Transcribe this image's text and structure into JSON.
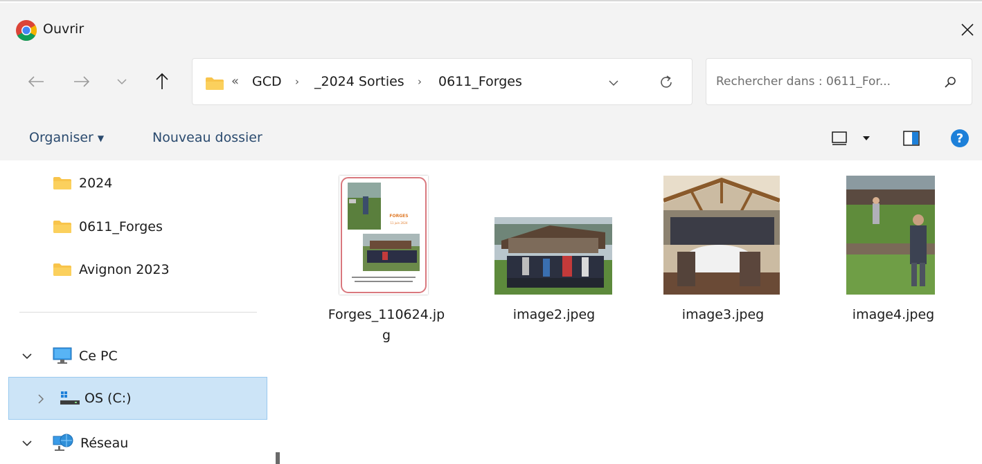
{
  "window": {
    "title": "Ouvrir"
  },
  "navigation": {
    "breadcrumbs": [
      "GCD",
      "_2024 Sorties",
      "0611_Forges"
    ],
    "overflow_glyph": "«",
    "separator_glyph": "›"
  },
  "search": {
    "placeholder": "Rechercher dans : 0611_For..."
  },
  "commands": {
    "organise_label": "Organiser",
    "new_folder_label": "Nouveau dossier",
    "help_glyph": "?"
  },
  "sidebar": {
    "folders": [
      {
        "label": "2024",
        "icon": "folder-icon"
      },
      {
        "label": "0611_Forges",
        "icon": "folder-icon"
      },
      {
        "label": "Avignon 2023",
        "icon": "folder-icon"
      }
    ],
    "this_pc_label": "Ce PC",
    "drive_label": "OS (C:)",
    "network_label": "Réseau"
  },
  "files": [
    {
      "name_line1": "Forges_110624.jp",
      "name_line2": "g",
      "thumb_title": "FORGES",
      "thumb_date": "11 juin 2024"
    },
    {
      "name_line1": "image2.jpeg"
    },
    {
      "name_line1": "image3.jpeg"
    },
    {
      "name_line1": "image4.jpeg"
    }
  ],
  "colors": {
    "accent": "#0067c0",
    "selection": "#cce4f7",
    "folder": "#f8c44b",
    "help": "#1d80d9"
  }
}
